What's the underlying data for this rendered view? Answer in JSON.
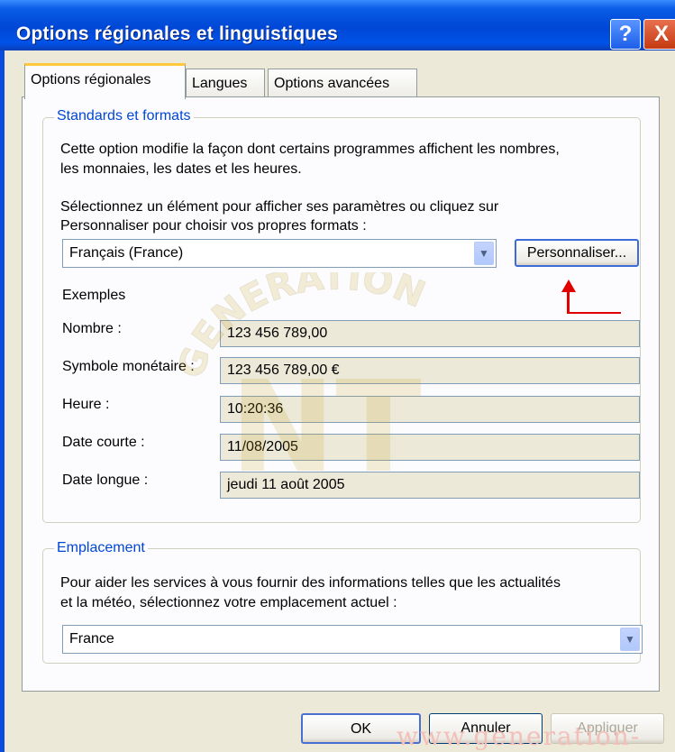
{
  "window": {
    "title": "Options régionales et linguistiques",
    "help_glyph": "?",
    "close_glyph": "X"
  },
  "tabs": [
    {
      "label": "Options régionales"
    },
    {
      "label": "Langues"
    },
    {
      "label": "Options avancées"
    }
  ],
  "standards": {
    "legend": "Standards et formats",
    "desc_line1": "Cette option modifie la façon dont certains programmes affichent les nombres,",
    "desc_line2": "les monnaies, les dates et les heures.",
    "select_line1": "Sélectionnez un élément pour afficher ses paramètres ou cliquez sur",
    "select_line2": "Personnaliser pour choisir vos propres formats :",
    "locale_value": "Français (France)",
    "customize_label": "Personnaliser...",
    "examples_label": "Exemples",
    "examples": [
      {
        "label": "Nombre :",
        "value": "123 456 789,00"
      },
      {
        "label": "Symbole monétaire :",
        "value": "123 456 789,00 €"
      },
      {
        "label": "Heure :",
        "value": "10:20:36"
      },
      {
        "label": "Date courte :",
        "value": "11/08/2005"
      },
      {
        "label": "Date longue :",
        "value": "jeudi 11 août 2005"
      }
    ]
  },
  "location": {
    "legend": "Emplacement",
    "desc_line1": "Pour aider les services à vous fournir des informations telles que les actualités",
    "desc_line2": "et la météo, sélectionnez votre emplacement actuel :",
    "value": "France"
  },
  "buttons": {
    "ok": "OK",
    "cancel": "Annuler",
    "apply": "Appliquer"
  },
  "watermark": {
    "arc_text": "GENERATION",
    "letters": "NT",
    "footer": "www.generation-nt.com"
  },
  "colors": {
    "accent": "#0046d5",
    "arrow": "#e00000",
    "title_bar": "#0052e8"
  },
  "icons": {
    "dropdown": "chevron-down-icon",
    "help": "help-icon",
    "close": "close-icon"
  }
}
